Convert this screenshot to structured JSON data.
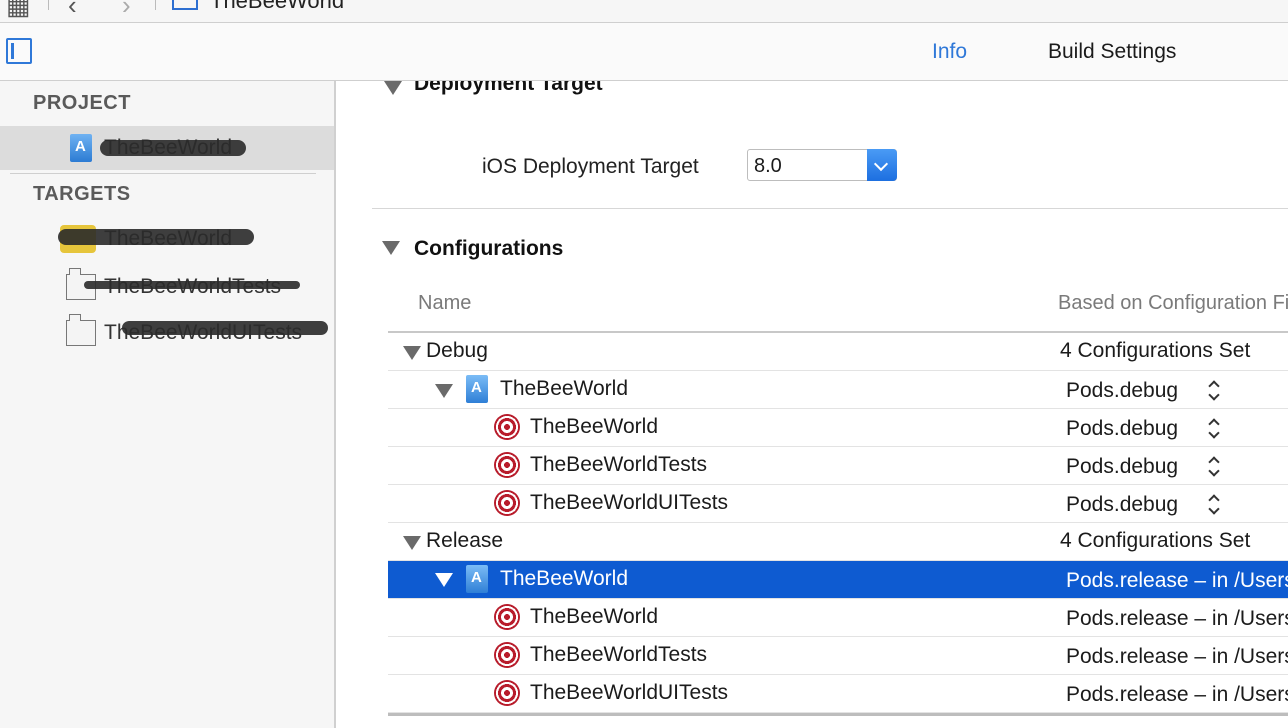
{
  "window": {
    "title": "TheBeeWorld"
  },
  "editor": {
    "tabs": [
      {
        "label": "Info",
        "active": true
      },
      {
        "label": "Build Settings",
        "active": false
      }
    ]
  },
  "sidebar": {
    "project_header": "PROJECT",
    "project_item": "TheBeeWorld",
    "targets_header": "TARGETS",
    "targets": [
      {
        "label": "TheBeeWorld",
        "icon": "app-icon"
      },
      {
        "label": "TheBeeWorldTests",
        "icon": "test-bundle-icon"
      },
      {
        "label": "TheBeeWorldUITests",
        "icon": "test-bundle-icon"
      }
    ]
  },
  "deployment": {
    "section_title": "Deployment Target",
    "field_label": "iOS Deployment Target",
    "field_value": "8.0"
  },
  "configurations": {
    "section_title": "Configurations",
    "columns": {
      "name": "Name",
      "based_on": "Based on Configuration File"
    },
    "rows": [
      {
        "name": "Debug",
        "value": "4 Configurations Set"
      },
      {
        "name": "TheBeeWorld",
        "value": "Pods.debug"
      },
      {
        "name": "TheBeeWorld",
        "value": "Pods.debug"
      },
      {
        "name": "TheBeeWorldTests",
        "value": "Pods.debug"
      },
      {
        "name": "TheBeeWorldUITests",
        "value": "Pods.debug"
      },
      {
        "name": "Release",
        "value": "4 Configurations Set"
      },
      {
        "name": "TheBeeWorld",
        "value": "Pods.release – in /Users"
      },
      {
        "name": "TheBeeWorld",
        "value": "Pods.release – in /Users"
      },
      {
        "name": "TheBeeWorldTests",
        "value": "Pods.release – in /Users"
      },
      {
        "name": "TheBeeWorldUITests",
        "value": "Pods.release – in /Users"
      }
    ]
  },
  "colors": {
    "accent": "#2f78d8",
    "selection": "#0e5bd1",
    "target_icon": "#b81c2b"
  }
}
